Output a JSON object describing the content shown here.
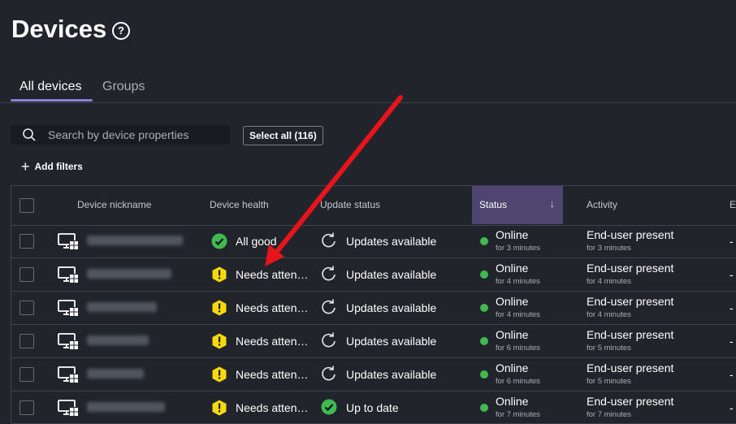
{
  "page": {
    "title": "Devices",
    "help_icon": "help-circle-icon"
  },
  "tabs": [
    {
      "label": "All devices",
      "active": true
    },
    {
      "label": "Groups",
      "active": false
    }
  ],
  "search": {
    "placeholder": "Search by device properties"
  },
  "select_all_label": "Select all (116)",
  "add_filters_label": "Add filters",
  "table": {
    "columns": [
      "Device nickname",
      "Device health",
      "Update status",
      "Status",
      "Activity",
      "E"
    ],
    "sorted_column": "Status",
    "rows": [
      {
        "health": "All good",
        "health_state": "good",
        "update": "Updates available",
        "update_state": "available",
        "status": "Online",
        "status_since": "for 3 minutes",
        "activity": "End-user present",
        "activity_since": "for 3 minutes",
        "extra": "-"
      },
      {
        "health": "Needs atten…",
        "health_state": "warning",
        "update": "Updates available",
        "update_state": "available",
        "status": "Online",
        "status_since": "for 4 minutes",
        "activity": "End-user present",
        "activity_since": "for 4 minutes",
        "extra": "-"
      },
      {
        "health": "Needs atten…",
        "health_state": "warning",
        "update": "Updates available",
        "update_state": "available",
        "status": "Online",
        "status_since": "for 4 minutes",
        "activity": "End-user present",
        "activity_since": "for 4 minutes",
        "extra": "-"
      },
      {
        "health": "Needs atten…",
        "health_state": "warning",
        "update": "Updates available",
        "update_state": "available",
        "status": "Online",
        "status_since": "for 6 minutes",
        "activity": "End-user present",
        "activity_since": "for 5 minutes",
        "extra": "-"
      },
      {
        "health": "Needs atten…",
        "health_state": "warning",
        "update": "Updates available",
        "update_state": "available",
        "status": "Online",
        "status_since": "for 6 minutes",
        "activity": "End-user present",
        "activity_since": "for 5 minutes",
        "extra": "-"
      },
      {
        "health": "Needs atten…",
        "health_state": "warning",
        "update": "Up to date",
        "update_state": "current",
        "status": "Online",
        "status_since": "for 7 minutes",
        "activity": "End-user present",
        "activity_since": "for 7 minutes",
        "extra": "-"
      }
    ]
  },
  "colors": {
    "accent": "#8b7fd9",
    "online": "#3fb950",
    "warning": "#f5d90a",
    "good": "#3fb950",
    "annotation_arrow": "#e8141b"
  }
}
